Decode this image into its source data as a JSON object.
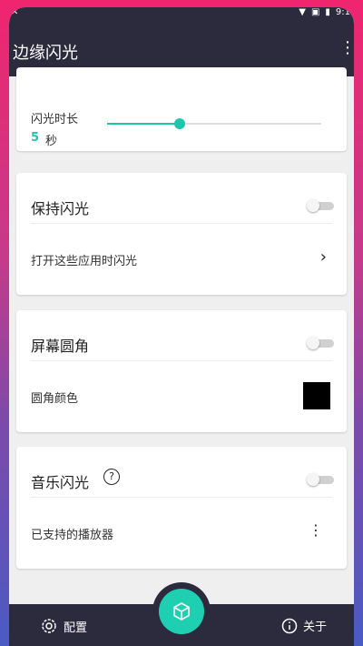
{
  "statusbar": {
    "time": "9:1"
  },
  "appbar": {
    "title": "边缘闪光",
    "menu_icon": "more-vert-icon"
  },
  "flash_duration": {
    "label": "闪光时长",
    "value": "5",
    "unit": "秒",
    "slider_fraction": 0.34,
    "accent": "#1cc7ad"
  },
  "keep_flash": {
    "title": "保持闪光",
    "enabled": false,
    "row_label": "打开这些应用时闪光"
  },
  "rounded_corners": {
    "title": "屏幕圆角",
    "enabled": false,
    "color_label": "圆角颜色",
    "color": "#000000"
  },
  "music_flash": {
    "title": "音乐闪光",
    "enabled": false,
    "row_label": "已支持的播放器"
  },
  "bottom": {
    "config_label": "配置",
    "about_label": "关于",
    "fab_icon": "cube-icon"
  }
}
